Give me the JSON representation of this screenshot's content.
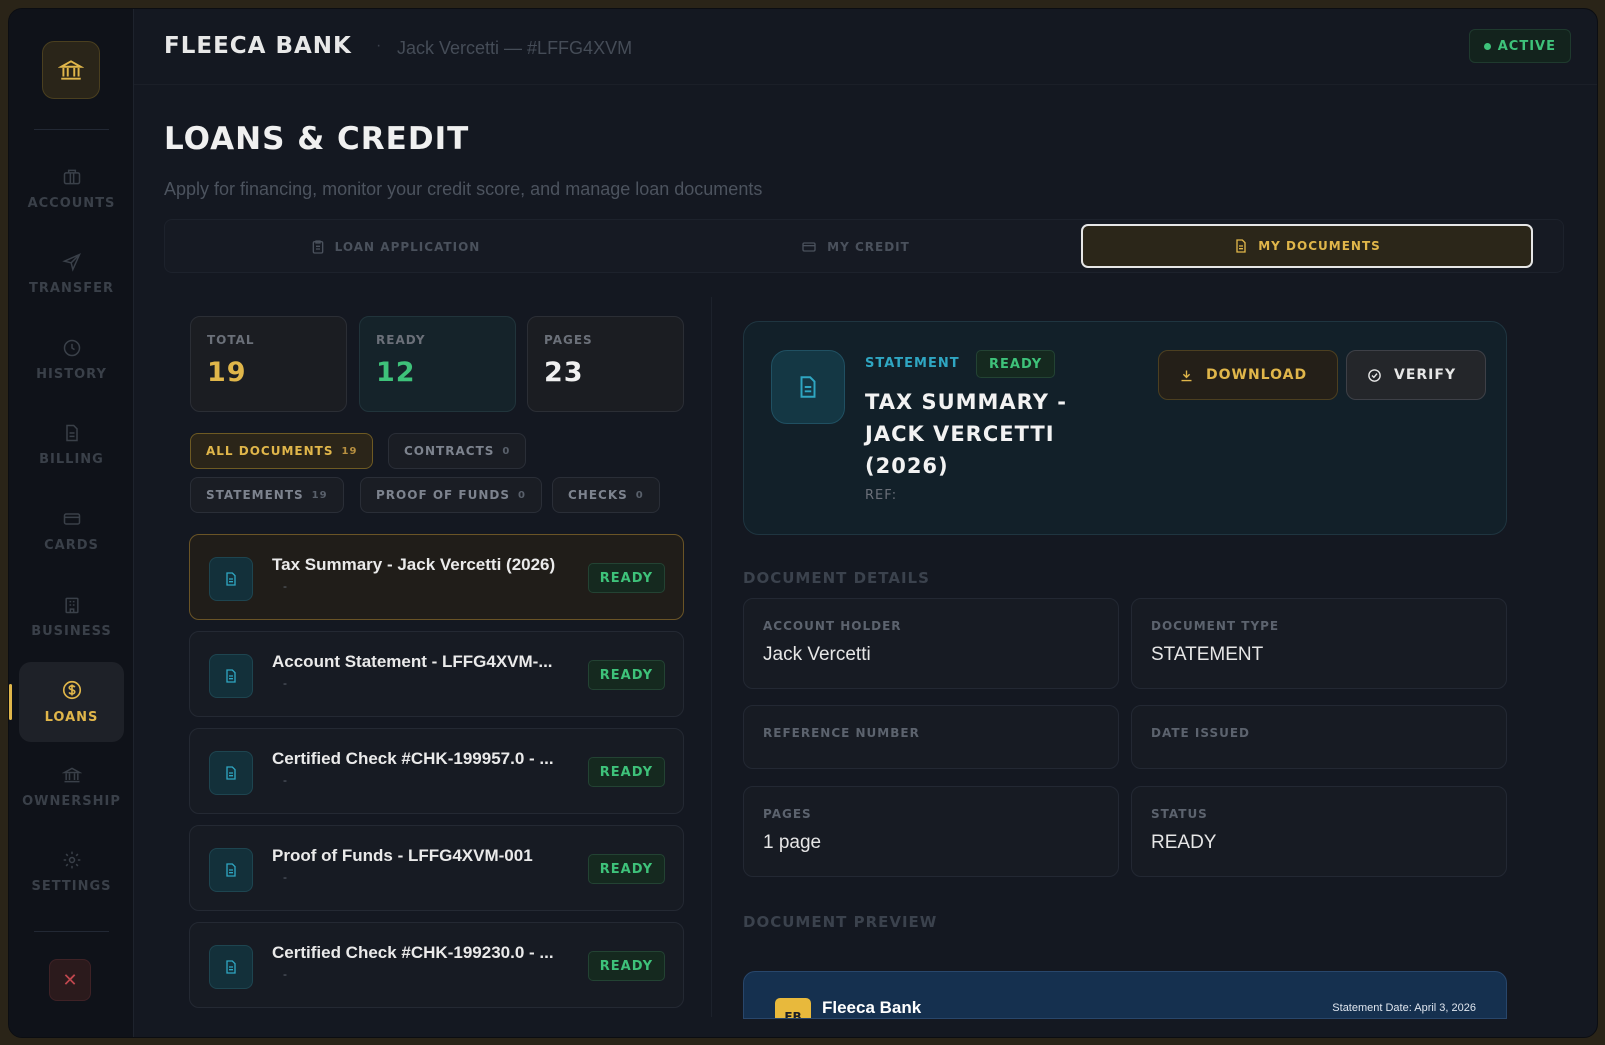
{
  "header": {
    "bank_name": "FLEECA BANK",
    "separator": "·",
    "user_info": "Jack Vercetti — #LFFG4XVM",
    "status": "ACTIVE"
  },
  "sidebar": {
    "items": [
      {
        "label": "ACCOUNTS",
        "icon": "briefcase-icon"
      },
      {
        "label": "TRANSFER",
        "icon": "send-icon"
      },
      {
        "label": "HISTORY",
        "icon": "clock-icon"
      },
      {
        "label": "BILLING",
        "icon": "file-icon"
      },
      {
        "label": "CARDS",
        "icon": "card-icon"
      },
      {
        "label": "BUSINESS",
        "icon": "building-icon"
      },
      {
        "label": "LOANS",
        "icon": "dollar-circle-icon",
        "active": true
      },
      {
        "label": "OWNERSHIP",
        "icon": "bank-icon"
      },
      {
        "label": "SETTINGS",
        "icon": "gear-icon"
      }
    ],
    "close_glyph": "✕"
  },
  "page": {
    "title": "LOANS & CREDIT",
    "subtitle": "Apply for financing, monitor your credit score, and manage loan documents"
  },
  "tabs": [
    {
      "label": "LOAN APPLICATION",
      "icon": "clipboard-icon"
    },
    {
      "label": "MY CREDIT",
      "icon": "card-icon"
    },
    {
      "label": "MY DOCUMENTS",
      "icon": "document-icon",
      "active": true
    }
  ],
  "stats": [
    {
      "label": "TOTAL",
      "value": "19",
      "color": "#e0b64a"
    },
    {
      "label": "READY",
      "value": "12",
      "color": "#3ec27a"
    },
    {
      "label": "PAGES",
      "value": "23",
      "color": "#f0f0f0"
    }
  ],
  "filters": [
    {
      "label": "ALL DOCUMENTS",
      "count": "19",
      "active": true
    },
    {
      "label": "CONTRACTS",
      "count": "0"
    },
    {
      "label": "STATEMENTS",
      "count": "19"
    },
    {
      "label": "PROOF OF FUNDS",
      "count": "0"
    },
    {
      "label": "CHECKS",
      "count": "0"
    }
  ],
  "documents": [
    {
      "title": "Tax Summary - Jack Vercetti (2026)",
      "sub": "-",
      "status": "READY"
    },
    {
      "title": "Account Statement - LFFG4XVM-...",
      "sub": "-",
      "status": "READY"
    },
    {
      "title": "Certified Check #CHK-199957.0 - ...",
      "sub": "-",
      "status": "READY"
    },
    {
      "title": "Proof of Funds - LFFG4XVM-001",
      "sub": "-",
      "status": "READY"
    },
    {
      "title": "Certified Check #CHK-199230.0 - ...",
      "sub": "-",
      "status": "READY"
    }
  ],
  "detail": {
    "type": "STATEMENT",
    "status": "READY",
    "title": "TAX SUMMARY - JACK VERCETTI (2026)",
    "ref_label": "REF:",
    "download_label": "DOWNLOAD",
    "verify_label": "VERIFY"
  },
  "details_section": {
    "label": "DOCUMENT DETAILS",
    "fields": [
      {
        "label": "ACCOUNT HOLDER",
        "value": "Jack Vercetti"
      },
      {
        "label": "DOCUMENT TYPE",
        "value": "STATEMENT"
      },
      {
        "label": "REFERENCE NUMBER",
        "value": ""
      },
      {
        "label": "DATE ISSUED",
        "value": ""
      },
      {
        "label": "PAGES",
        "value": "1 page"
      },
      {
        "label": "STATUS",
        "value": "READY"
      }
    ]
  },
  "preview": {
    "label": "DOCUMENT PREVIEW",
    "badge": "FB",
    "bank": "Fleeca Bank",
    "date": "Statement Date: April 3, 2026"
  },
  "colors": {
    "accent": "#e0b64a",
    "success": "#3ec27a",
    "info": "#2fa6c2",
    "danger": "#c0474e"
  }
}
